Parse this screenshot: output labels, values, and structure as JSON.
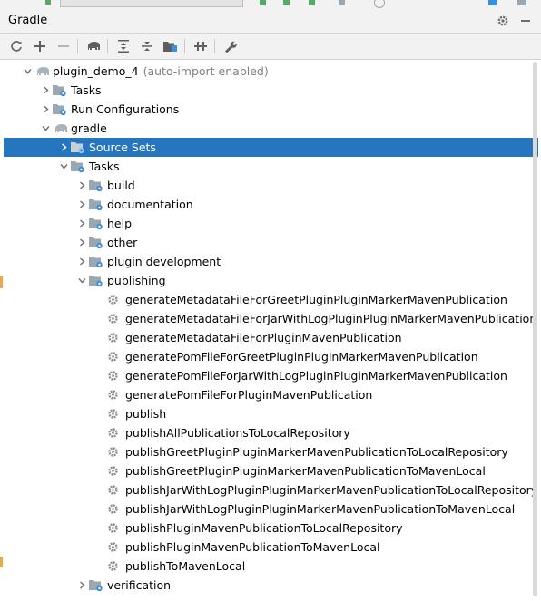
{
  "panel": {
    "title": "Gradle"
  },
  "header_icons": [
    "gear-icon",
    "minimize-icon"
  ],
  "toolbar_icons": [
    "refresh-icon",
    "add-icon",
    "remove-icon",
    "gradle-elephant-icon",
    "expand-all-icon",
    "collapse-all-icon",
    "group-tasks-icon",
    "toggle-offline-icon",
    "wrench-icon"
  ],
  "colors": {
    "selection": "#2675bf",
    "folder": "#9aa7b0",
    "gear": "#8a8f94",
    "accent": "#3d8fd6",
    "dim_text": "#808080"
  },
  "tree": {
    "root": {
      "label": "plugin_demo_4",
      "suffix": "(auto-import enabled)"
    },
    "tasks_top": "Tasks",
    "run_configurations": "Run Configurations",
    "gradle": "gradle",
    "source_sets": "Source Sets",
    "tasks": "Tasks",
    "groups": [
      "build",
      "documentation",
      "help",
      "other",
      "plugin development",
      "publishing"
    ],
    "publishing_tasks": [
      "generateMetadataFileForGreetPluginPluginMarkerMavenPublication",
      "generateMetadataFileForJarWithLogPluginPluginMarkerMavenPublication",
      "generateMetadataFileForPluginMavenPublication",
      "generatePomFileForGreetPluginPluginMarkerMavenPublication",
      "generatePomFileForJarWithLogPluginPluginMarkerMavenPublication",
      "generatePomFileForPluginMavenPublication",
      "publish",
      "publishAllPublicationsToLocalRepository",
      "publishGreetPluginPluginMarkerMavenPublicationToLocalRepository",
      "publishGreetPluginPluginMarkerMavenPublicationToMavenLocal",
      "publishJarWithLogPluginPluginMarkerMavenPublicationToLocalRepository",
      "publishJarWithLogPluginPluginMarkerMavenPublicationToMavenLocal",
      "publishPluginMavenPublicationToLocalRepository",
      "publishPluginMavenPublicationToMavenLocal",
      "publishToMavenLocal"
    ],
    "verification": "verification"
  }
}
